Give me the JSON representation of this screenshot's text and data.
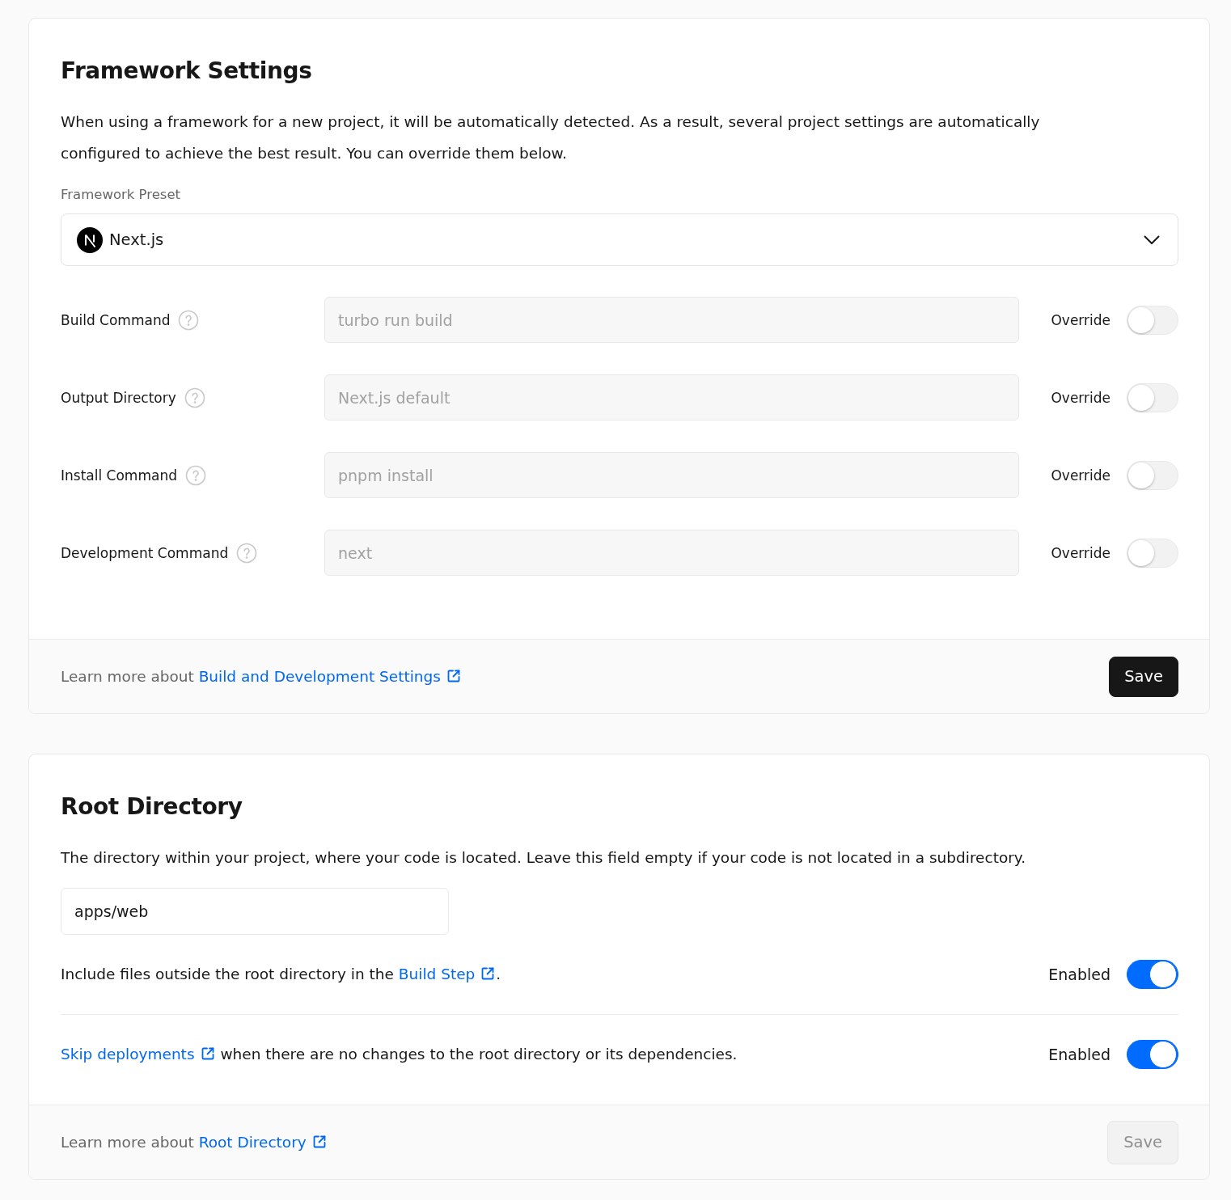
{
  "framework_settings": {
    "title": "Framework Settings",
    "description": "When using a framework for a new project, it will be automatically detected. As a result, several project settings are automatically configured to achieve the best result. You can override them below.",
    "preset": {
      "label": "Framework Preset",
      "value": "Next.js"
    },
    "commands": [
      {
        "label": "Build Command",
        "placeholder": "turbo run build",
        "toggle_label": "Override",
        "on": false
      },
      {
        "label": "Output Directory",
        "placeholder": "Next.js default",
        "toggle_label": "Override",
        "on": false
      },
      {
        "label": "Install Command",
        "placeholder": "pnpm install",
        "toggle_label": "Override",
        "on": false
      },
      {
        "label": "Development Command",
        "placeholder": "next",
        "toggle_label": "Override",
        "on": false
      }
    ],
    "footer": {
      "text": "Learn more about",
      "link": "Build and Development Settings",
      "save": {
        "label": "Save",
        "disabled": false
      }
    }
  },
  "root_directory": {
    "title": "Root Directory",
    "description": "The directory within your project, where your code is located. Leave this field empty if your code is not located in a subdirectory.",
    "value": "apps/web",
    "options": [
      {
        "parts": [
          {
            "kind": "text",
            "text": "Include files outside the root directory in the "
          },
          {
            "kind": "link",
            "text": "Build Step"
          },
          {
            "kind": "text",
            "text": "."
          }
        ],
        "status": "Enabled",
        "on": true
      },
      {
        "parts": [
          {
            "kind": "link",
            "text": "Skip deployments"
          },
          {
            "kind": "text",
            "text": " when there are no changes to the root directory or its dependencies."
          }
        ],
        "status": "Enabled",
        "on": true
      }
    ],
    "footer": {
      "text": "Learn more about",
      "link": "Root Directory",
      "save": {
        "label": "Save",
        "disabled": true
      }
    }
  }
}
